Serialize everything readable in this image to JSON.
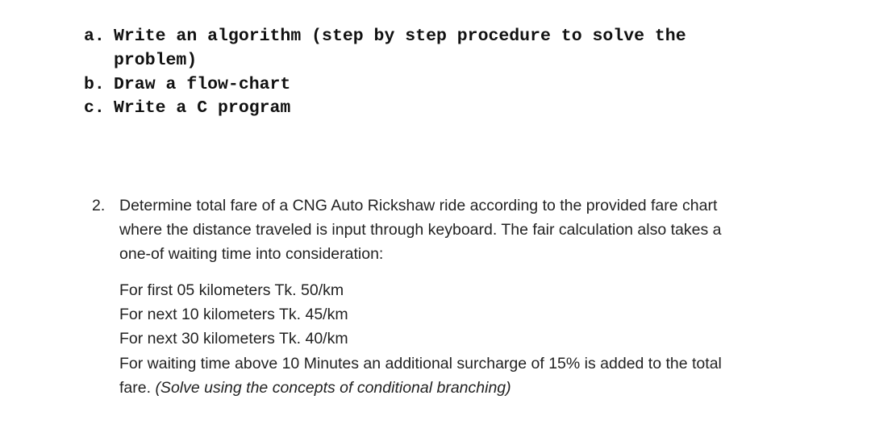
{
  "sub_tasks": [
    {
      "marker": "a.",
      "text": "Write an algorithm (step by step procedure to solve the",
      "continuation": "problem)"
    },
    {
      "marker": "b.",
      "text": "Draw a flow-chart"
    },
    {
      "marker": "c.",
      "text": "Write a C program"
    }
  ],
  "question": {
    "number": "2.",
    "intro_lines": [
      "Determine total fare of a CNG Auto Rickshaw ride according to the provided fare chart",
      "where the distance traveled is input through keyboard. The fair calculation also takes a",
      "one-of waiting time into consideration:"
    ],
    "fare_chart": [
      "For first 05 kilometers Tk. 50/km",
      "For next 10 kilometers Tk. 45/km",
      "For next 30 kilometers Tk. 40/km",
      "For waiting time above 10 Minutes an additional surcharge of 15% is added to the total"
    ],
    "last_line_prefix": "fare. ",
    "last_line_note": "(Solve using the concepts of conditional branching)"
  }
}
